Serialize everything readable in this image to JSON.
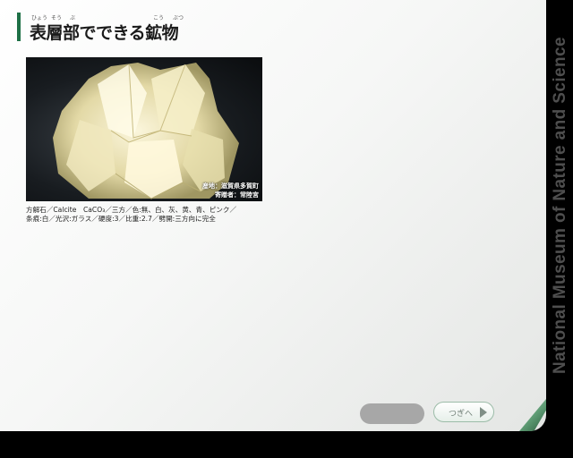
{
  "header": {
    "title": "表層部でできる鉱物",
    "furigana": [
      "ひょう",
      "そう",
      "ぶ",
      "こう",
      "ぶつ"
    ]
  },
  "side_title": "National Museum of Nature and Science",
  "specimen": {
    "caption_locality": "産地：滋賀県多賀町",
    "caption_donor": "寄贈者：常陸宮",
    "description_line1": "方解石／Calcite　CaCO₃／三方／色:無、白、灰、黄、青、ピンク／",
    "description_line2": "条痕:白／光沢:ガラス／硬度:3／比重:2.7／劈開:三方向に完全"
  },
  "nav": {
    "next_label": "つぎへ"
  },
  "colors": {
    "accent": "#1e7046",
    "page_curl": "#5c9a72",
    "prev_button": "#a7a7a7"
  }
}
